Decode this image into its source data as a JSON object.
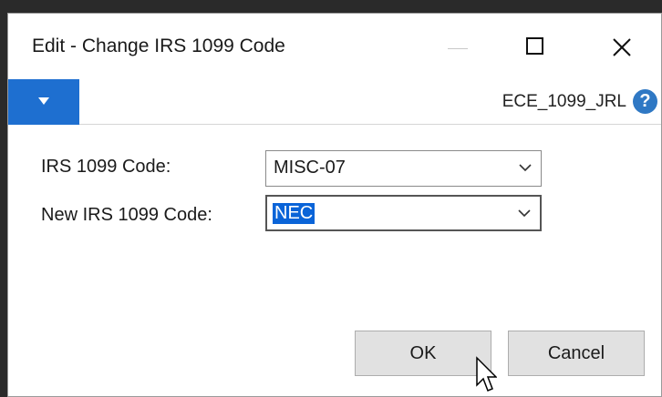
{
  "window": {
    "title": "Edit - Change IRS 1099 Code"
  },
  "ribbon": {
    "company": "ECE_1099_JRL",
    "help_glyph": "?"
  },
  "form": {
    "irs_code_label": "IRS 1099 Code:",
    "irs_code_value": "MISC-07",
    "new_code_label": "New IRS 1099 Code:",
    "new_code_value": "NEC"
  },
  "buttons": {
    "ok": "OK",
    "cancel": "Cancel"
  },
  "colors": {
    "accent": "#1e6fd0",
    "selection": "#0a64d8",
    "help": "#2f78c4"
  }
}
